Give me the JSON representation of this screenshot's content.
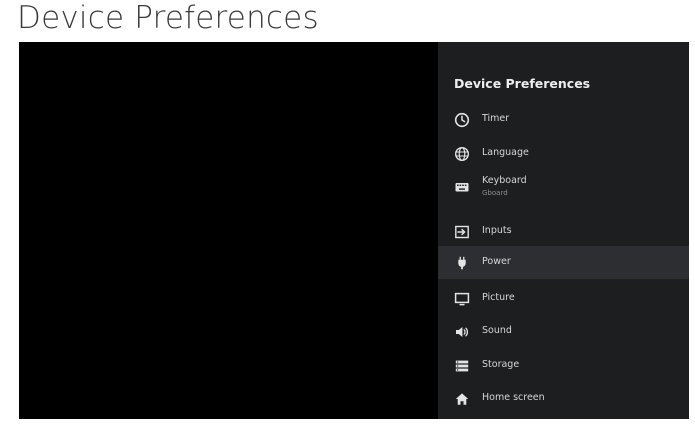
{
  "page": {
    "heading": "Device Preferences"
  },
  "panel": {
    "title": "Device Preferences",
    "items": [
      {
        "label": "Timer",
        "icon": "clock-icon"
      },
      {
        "label": "Language",
        "icon": "globe-icon"
      },
      {
        "label": "Keyboard",
        "sub": "Gboard",
        "icon": "keyboard-icon"
      },
      {
        "label": "Inputs",
        "icon": "input-icon"
      },
      {
        "label": "Power",
        "icon": "power-plug-icon",
        "selected": true
      },
      {
        "label": "Picture",
        "icon": "monitor-icon"
      },
      {
        "label": "Sound",
        "icon": "speaker-icon"
      },
      {
        "label": "Storage",
        "icon": "storage-icon"
      },
      {
        "label": "Home screen",
        "icon": "home-icon"
      }
    ]
  },
  "colors": {
    "screen_background": "#000000",
    "panel_background": "#1d1e20",
    "selected_row": "#2d2e31",
    "text_primary": "#eeeeee"
  }
}
